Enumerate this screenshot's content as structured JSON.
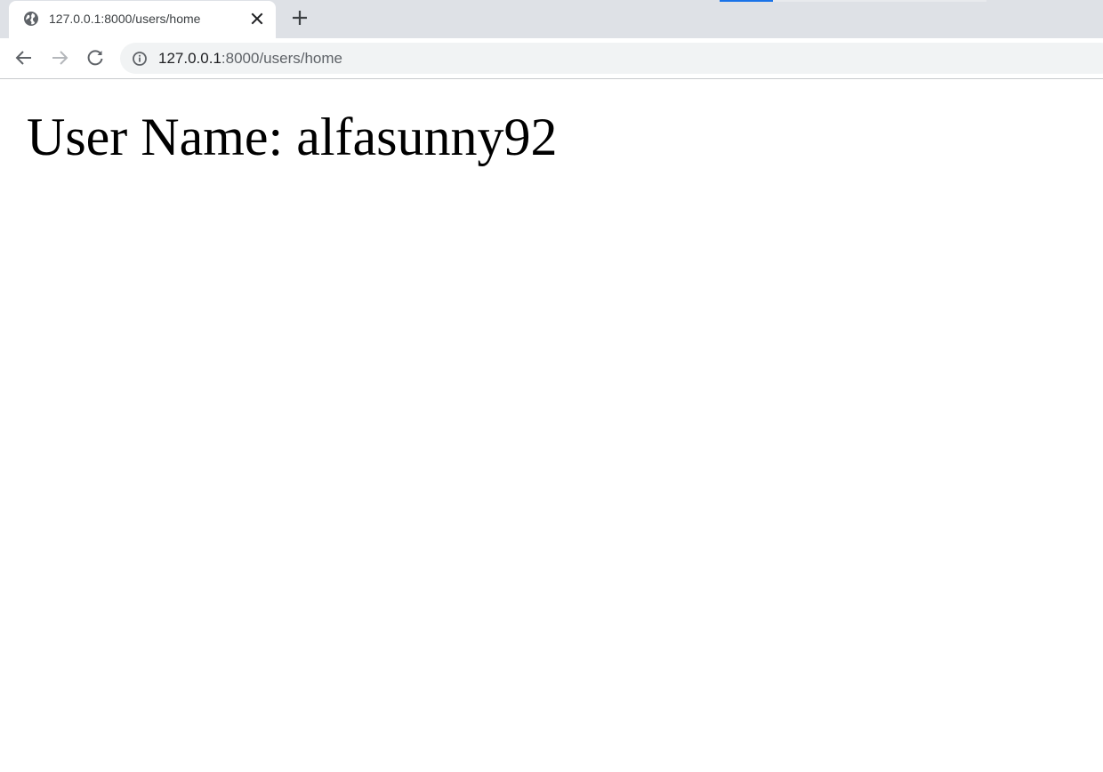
{
  "browser": {
    "tab": {
      "title": "127.0.0.1:8000/users/home",
      "favicon": "globe-icon"
    },
    "omnibox": {
      "url_host": "127.0.0.1",
      "url_rest": ":8000/users/home",
      "security_icon": "info-icon"
    },
    "colors": {
      "tabstrip": "#dee1e6",
      "omnibox": "#f1f3f4",
      "accent": "#1a73e8"
    }
  },
  "page": {
    "heading": "User Name: alfasunny92"
  }
}
